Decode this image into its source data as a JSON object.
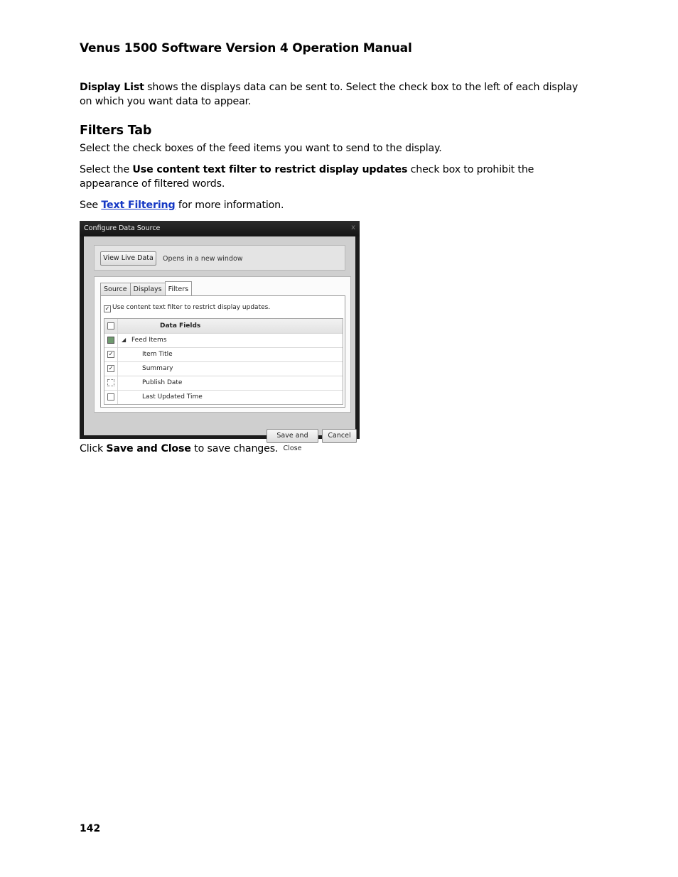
{
  "header": {
    "title": "Venus 1500 Software Version 4 Operation Manual"
  },
  "intro": {
    "bold": "Display List",
    "rest": " shows the displays data can be sent to. Select the check box to the left of each display on which you want data to appear."
  },
  "filters_section": {
    "heading": "Filters Tab",
    "p1": "Select the check boxes of the feed items you want to send to the display.",
    "p2_pre": "Select the ",
    "p2_bold": "Use content text filter to restrict display updates",
    "p2_post": " check box to prohibit the appearance of filtered words.",
    "p3_pre": "See ",
    "p3_link": "Text Filtering",
    "p3_post": " for more information."
  },
  "dialog": {
    "title": "Configure Data Source",
    "close_glyph": "x",
    "view_live_button": "View Live Data",
    "opens_note": "Opens in a new window",
    "tabs": [
      {
        "label": "Source"
      },
      {
        "label": "Displays"
      },
      {
        "label": "Filters"
      }
    ],
    "filter_checkbox_label": "Use content text filter to restrict display updates.",
    "grid_header": "Data Fields",
    "rows": [
      {
        "label": "Feed Items",
        "state": "partial"
      },
      {
        "label": "Item Title",
        "state": "checked"
      },
      {
        "label": "Summary",
        "state": "checked"
      },
      {
        "label": "Publish Date",
        "state": "unchecked"
      },
      {
        "label": "Last Updated Time",
        "state": "unchecked"
      }
    ],
    "check_glyph": "✓",
    "expand_glyph": "◢",
    "save_button": "Save and Close",
    "cancel_button": "Cancel"
  },
  "closing": {
    "pre": "Click ",
    "bold": "Save and Close",
    "post": " to save changes."
  },
  "footer": {
    "page_number": "142"
  },
  "colors": {
    "link": "#1538c4"
  }
}
